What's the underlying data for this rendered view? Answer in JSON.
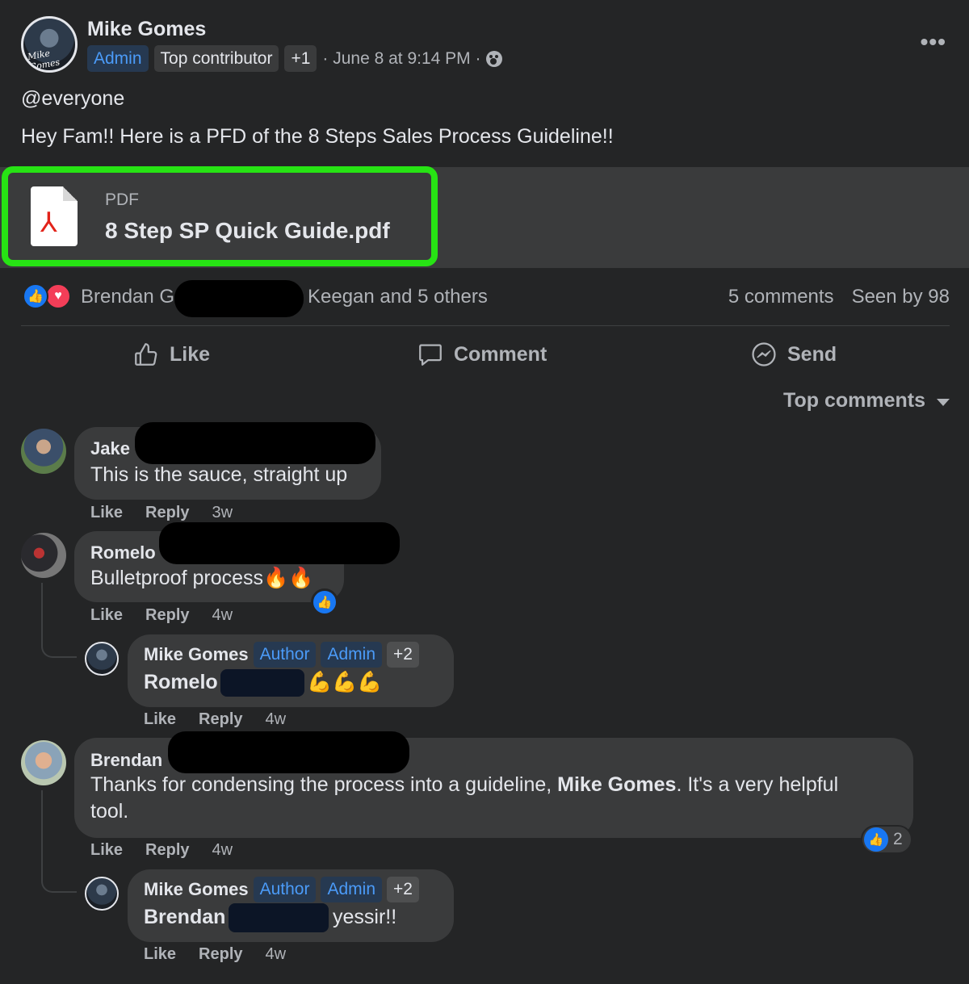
{
  "post": {
    "author": "Mike Gomes",
    "badges": [
      "Admin",
      "Top contributor",
      "+1"
    ],
    "time": "· June 8 at 9:14 PM ·",
    "more": "•••",
    "mention": "@everyone",
    "text": "Hey Fam!! Here is a PFD of the 8 Steps Sales Process Guideline!!"
  },
  "attachment": {
    "type": "PDF",
    "filename": "8 Step SP Quick Guide.pdf",
    "highlight_color": "#27e314"
  },
  "reactions": {
    "names_start": "Brendan G",
    "names_end": "Keegan and 5 others",
    "comments": "5 comments",
    "seen": "Seen by 98",
    "like_color": "#1877f2",
    "love_color": "#f33e58"
  },
  "actions": {
    "like": "Like",
    "comment": "Comment",
    "send": "Send"
  },
  "sort": {
    "label": "Top comments"
  },
  "comments": [
    {
      "name": "Jake",
      "text": "This is the sauce, straight up",
      "like": "Like",
      "reply": "Reply",
      "time": "3w"
    },
    {
      "name": "Romelo",
      "text": "Bulletproof process🔥🔥",
      "like": "Like",
      "reply": "Reply",
      "time": "4w",
      "reply_item": {
        "name": "Mike Gomes",
        "badges": [
          "Author",
          "Admin",
          "+2"
        ],
        "mention": "Romelo",
        "text": "💪💪💪",
        "like": "Like",
        "reply": "Reply",
        "time": "4w"
      }
    },
    {
      "name": "Brendan",
      "text_a": "Thanks for condensing the process into a guideline,",
      "text_bold": "Mike Gomes",
      "text_b": ". It's a very helpful",
      "text_c": "tool.",
      "reaction_count": "2",
      "like": "Like",
      "reply": "Reply",
      "time": "4w",
      "reply_item": {
        "name": "Mike Gomes",
        "badges": [
          "Author",
          "Admin",
          "+2"
        ],
        "mention": "Brendan",
        "text": "yessir!!",
        "like": "Like",
        "reply": "Reply",
        "time": "4w"
      }
    }
  ]
}
